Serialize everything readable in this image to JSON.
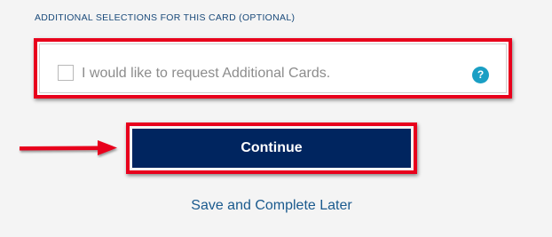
{
  "section": {
    "heading": "ADDITIONAL SELECTIONS FOR THIS CARD (OPTIONAL)"
  },
  "additional_cards": {
    "label": "I would like to request Additional Cards.",
    "checked": false,
    "help_icon": "question-mark-icon",
    "help_glyph": "?"
  },
  "actions": {
    "continue_label": "Continue",
    "save_later_label": "Save and Complete Later"
  },
  "colors": {
    "highlight_red": "#e8001c",
    "button_navy": "#00255f",
    "help_teal": "#1a9fc4",
    "link_blue": "#1a5a8e"
  }
}
